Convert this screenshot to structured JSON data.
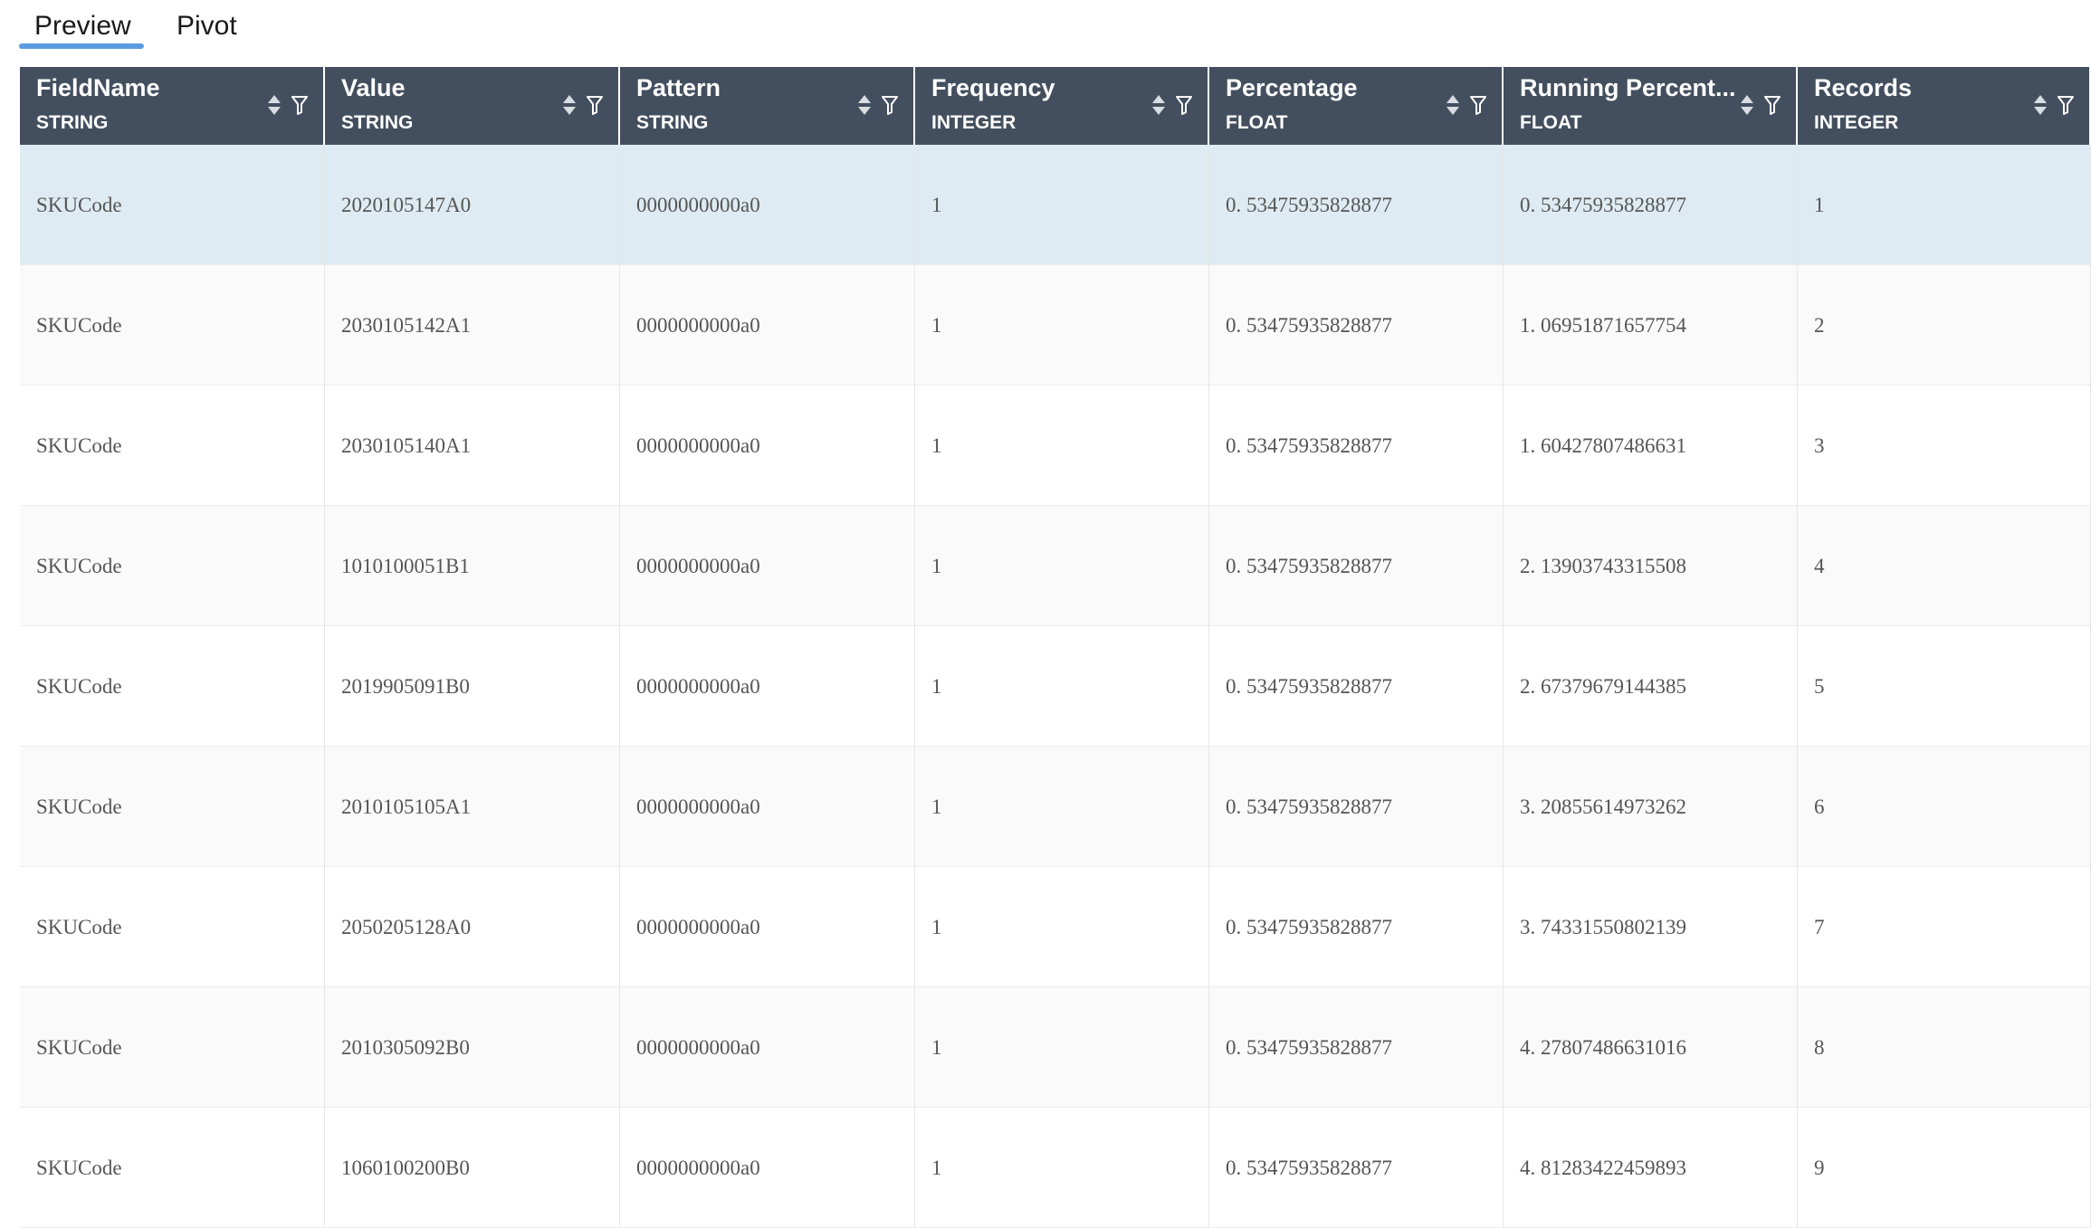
{
  "tabs": {
    "preview": "Preview",
    "pivot": "Pivot"
  },
  "columns": [
    {
      "name": "FieldName",
      "type": "STRING"
    },
    {
      "name": "Value",
      "type": "STRING"
    },
    {
      "name": "Pattern",
      "type": "STRING"
    },
    {
      "name": "Frequency",
      "type": "INTEGER"
    },
    {
      "name": "Percentage",
      "type": "FLOAT"
    },
    {
      "name": "Running Percent...",
      "type": "FLOAT"
    },
    {
      "name": "Records",
      "type": "INTEGER"
    }
  ],
  "rows": [
    [
      "SKUCode",
      "2020105147A0",
      "0000000000a0",
      "1",
      "0. 53475935828877",
      "0. 53475935828877",
      "1"
    ],
    [
      "SKUCode",
      "2030105142A1",
      "0000000000a0",
      "1",
      "0. 53475935828877",
      "1. 06951871657754",
      "2"
    ],
    [
      "SKUCode",
      "2030105140A1",
      "0000000000a0",
      "1",
      "0. 53475935828877",
      "1. 60427807486631",
      "3"
    ],
    [
      "SKUCode",
      "1010100051B1",
      "0000000000a0",
      "1",
      "0. 53475935828877",
      "2. 13903743315508",
      "4"
    ],
    [
      "SKUCode",
      "2019905091B0",
      "0000000000a0",
      "1",
      "0. 53475935828877",
      "2. 67379679144385",
      "5"
    ],
    [
      "SKUCode",
      "2010105105A1",
      "0000000000a0",
      "1",
      "0. 53475935828877",
      "3. 20855614973262",
      "6"
    ],
    [
      "SKUCode",
      "2050205128A0",
      "0000000000a0",
      "1",
      "0. 53475935828877",
      "3. 74331550802139",
      "7"
    ],
    [
      "SKUCode",
      "2010305092B0",
      "0000000000a0",
      "1",
      "0. 53475935828877",
      "4. 27807486631016",
      "8"
    ],
    [
      "SKUCode",
      "1060100200B0",
      "0000000000a0",
      "1",
      "0. 53475935828877",
      "4. 81283422459893",
      "9"
    ]
  ],
  "icons": {
    "sort": "sort-icon",
    "filter": "filter-icon"
  },
  "colors": {
    "header_bg": "#434f5e",
    "selected_row": "#deebf2",
    "tab_underline": "#5b9be3"
  },
  "selected_row_index": 0
}
